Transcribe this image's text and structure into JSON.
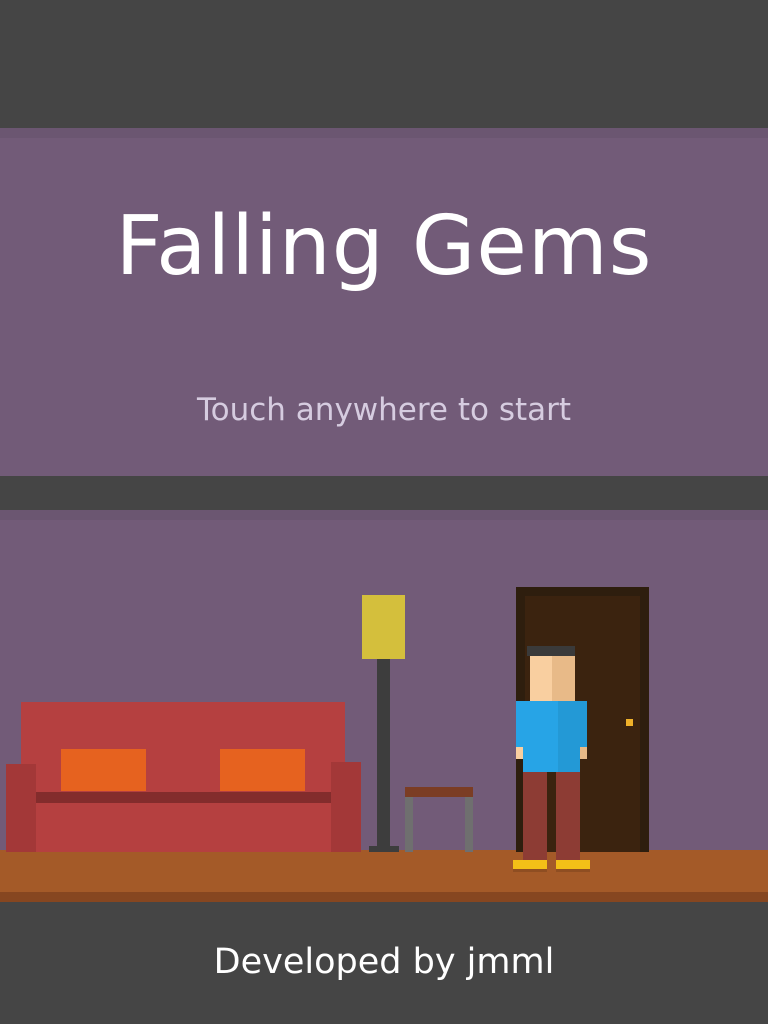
{
  "title": {
    "text": "Falling Gems",
    "prompt": "Touch anywhere to start"
  },
  "footer": {
    "credits": "Developed by jmml"
  },
  "colors": {
    "background": "#454545",
    "panel": "#725b78",
    "title_text": "#ffffff",
    "prompt_text": "#d6cce0",
    "floor": "#a45a28",
    "sofa": "#b54040",
    "cushion": "#e6621f",
    "lamp_shade": "#d4bf3c",
    "door": "#3b230f",
    "shirt": "#27a4e6",
    "pants": "#8d3c34",
    "shoes": "#f3c017"
  },
  "scene": {
    "objects": [
      "sofa",
      "floor-lamp",
      "side-table",
      "door",
      "player-character"
    ]
  }
}
